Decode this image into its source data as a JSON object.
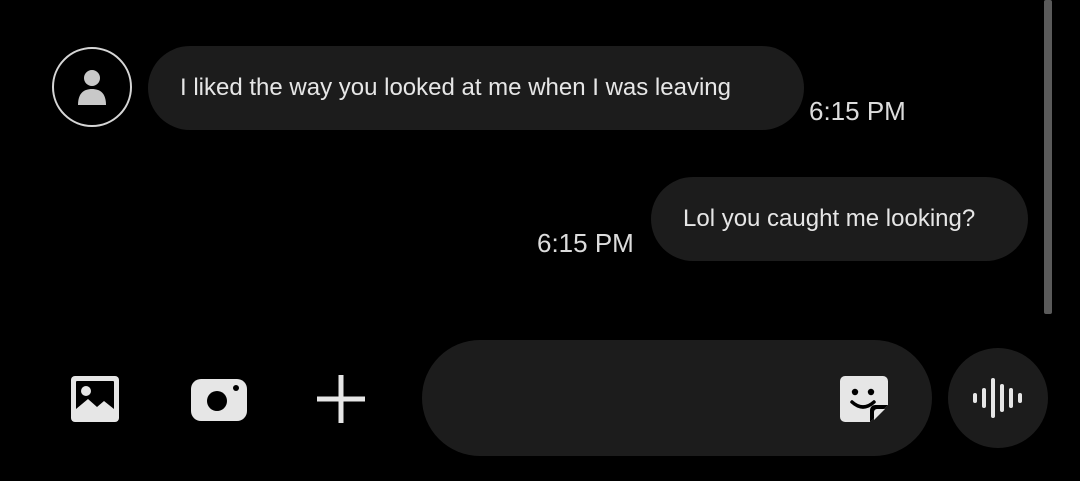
{
  "conversation": {
    "messages": [
      {
        "direction": "incoming",
        "text": "I liked the way you looked at me when I was leaving",
        "time": "6:15 PM"
      },
      {
        "direction": "outgoing",
        "text": "Lol you caught me looking?",
        "time": "6:15 PM"
      }
    ]
  },
  "icons": {
    "avatar": "person-icon",
    "gallery": "image-icon",
    "camera": "camera-icon",
    "add": "plus-icon",
    "sticker": "sticker-icon",
    "voice": "voice-waveform-icon"
  },
  "composer": {
    "value": "",
    "placeholder": ""
  },
  "colors": {
    "background": "#000000",
    "bubble": "#1c1c1c",
    "text": "#e6e6e6",
    "icon": "#e6e6e6"
  }
}
